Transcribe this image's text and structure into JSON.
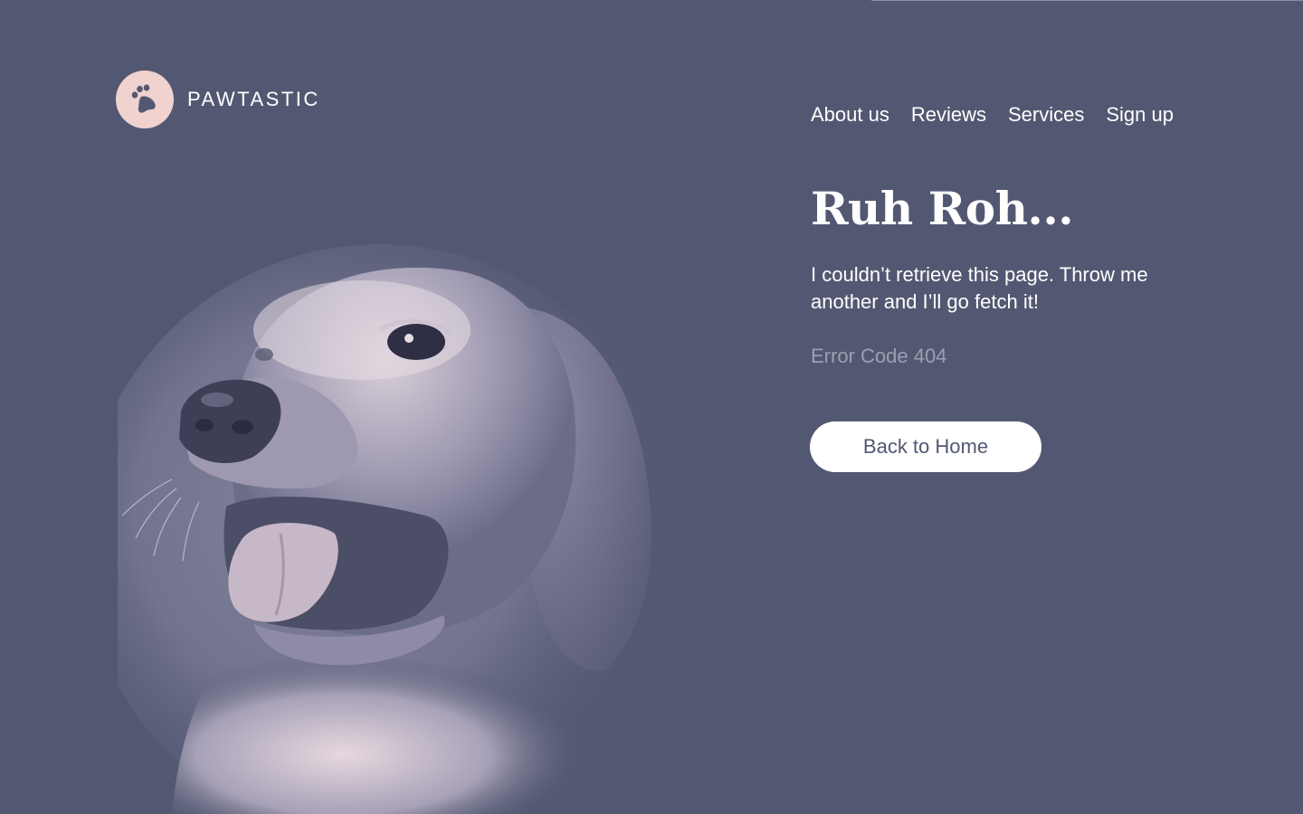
{
  "brand": {
    "name": "PAWTASTIC",
    "logo_icon": "paw-icon"
  },
  "nav": {
    "items": [
      {
        "label": "About us"
      },
      {
        "label": "Reviews"
      },
      {
        "label": "Services"
      },
      {
        "label": "Sign up"
      }
    ]
  },
  "error": {
    "heading": "Ruh Roh...",
    "message": "I couldn’t retrieve this page. Throw me another and I’ll go fetch it!",
    "code": "Error Code 404",
    "button_label": "Back to Home"
  },
  "colors": {
    "background": "#535872",
    "logo_bg": "#f0d2cf",
    "text": "#ffffff",
    "muted_text": "#9c9fb1",
    "button_bg": "#ffffff",
    "button_text": "#535872"
  },
  "hero_image": {
    "subject-icon": "dog-photo"
  }
}
